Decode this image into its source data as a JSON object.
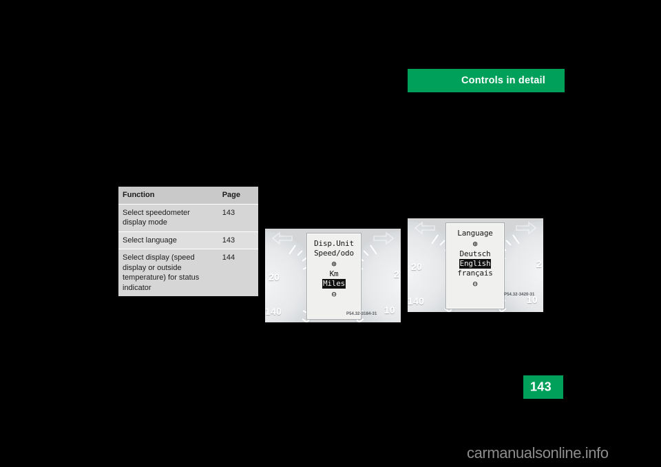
{
  "header": {
    "title": "Controls in detail",
    "accent_color": "#00a05a"
  },
  "table": {
    "columns": [
      "Function",
      "Page"
    ],
    "rows": [
      {
        "function": "Select speedometer display mode",
        "page": "143"
      },
      {
        "function": "Select language",
        "page": "143"
      },
      {
        "function": "Select display (speed display or outside temperature) for status indicator",
        "page": "144"
      }
    ]
  },
  "figures": [
    {
      "name": "display-unit-figure",
      "code": "P54.32-3184-31",
      "gauges": {
        "left_upper": "20",
        "left_lower": "140",
        "right_upper": "2",
        "right_lower": "10"
      },
      "lcd": {
        "title_line_1": "Disp.Unit",
        "title_line_2": "Speed/odo",
        "up_symbol": "⊕",
        "down_symbol": "⊖",
        "options": [
          "Km",
          "Miles"
        ],
        "selected": "Miles"
      }
    },
    {
      "name": "language-figure",
      "code": "P54.32-3420-31",
      "gauges": {
        "left_upper": "20",
        "left_lower": "140",
        "right_upper": "2",
        "right_lower": "10"
      },
      "lcd": {
        "title_line_1": "Language",
        "title_line_2": "",
        "up_symbol": "⊕",
        "down_symbol": "⊖",
        "options": [
          "Deutsch",
          "English",
          "français"
        ],
        "selected": "English"
      }
    }
  ],
  "page_number": "143",
  "watermark": "carmanualsonline.info"
}
